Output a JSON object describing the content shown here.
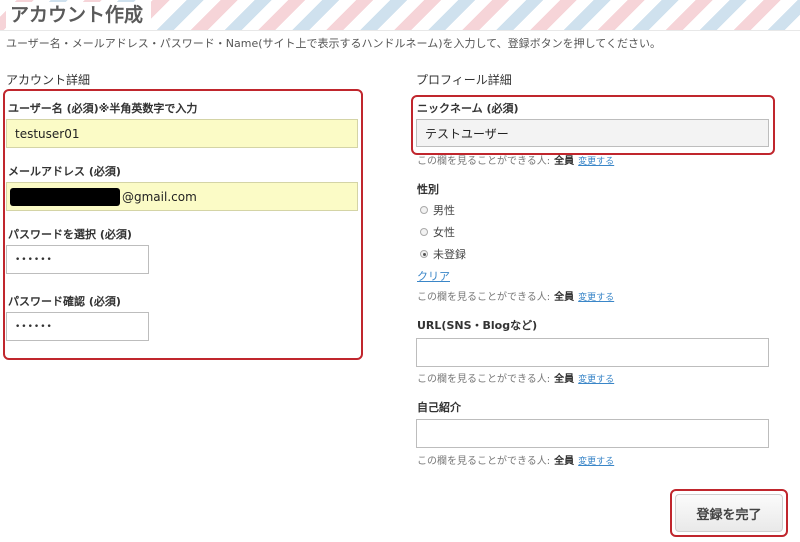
{
  "page": {
    "title": "アカウント作成",
    "intro": "ユーザー名・メールアドレス・パスワード・Name(サイト上で表示するハンドルネーム)を入力して、登録ボタンを押してください。"
  },
  "account": {
    "section_title": "アカウント詳細",
    "username_label": "ユーザー名 (必須)※半角英数字で入力",
    "username_value": "testuser01",
    "email_label": "メールアドレス (必須)",
    "email_value_suffix": "@gmail.com",
    "password_label": "パスワードを選択 (必須)",
    "password_value": "••••••",
    "password_confirm_label": "パスワード確認 (必須)",
    "password_confirm_value": "••••••"
  },
  "profile": {
    "section_title": "プロフィール詳細",
    "nickname_label": "ニックネーム (必須)",
    "nickname_value": "テストユーザー",
    "visibility_text": "この欄を見ることができる人:",
    "visibility_all": "全員",
    "visibility_change": "変更する",
    "gender_label": "性別",
    "gender_options": [
      "男性",
      "女性",
      "未登録"
    ],
    "gender_selected": "未登録",
    "clear_link": "クリア",
    "url_label": "URL(SNS・Blogなど)",
    "url_value": "",
    "bio_label": "自己紹介",
    "bio_value": ""
  },
  "actions": {
    "submit_label": "登録を完了"
  },
  "colors": {
    "highlight_border": "#c0262d",
    "autofill_bg": "#fbfbc6",
    "link": "#3a86c8"
  }
}
